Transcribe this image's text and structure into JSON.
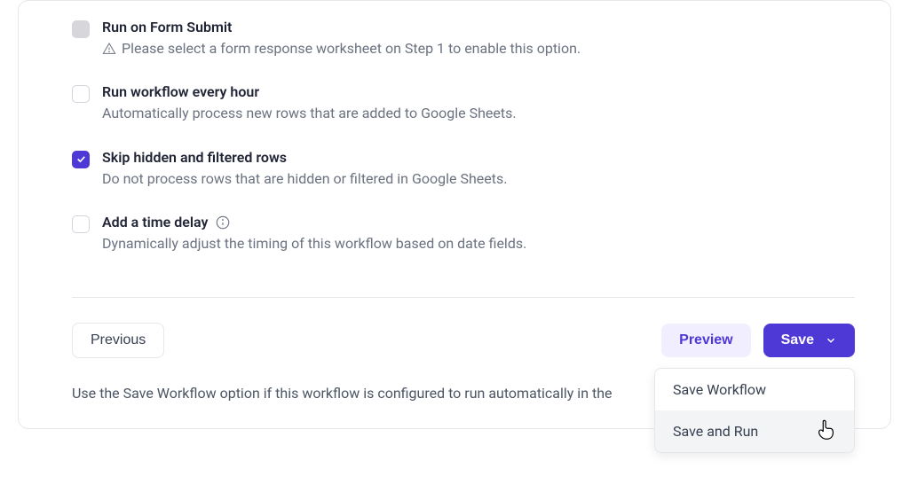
{
  "options": [
    {
      "title": "Run on Form Submit",
      "desc": "Please select a form response worksheet on Step 1 to enable this option.",
      "state": "disabled",
      "warning": true,
      "info": false
    },
    {
      "title": "Run workflow every hour",
      "desc": "Automatically process new rows that are added to Google Sheets.",
      "state": "empty",
      "warning": false,
      "info": false
    },
    {
      "title": "Skip hidden and filtered rows",
      "desc": "Do not process rows that are hidden or filtered in Google Sheets.",
      "state": "checked",
      "warning": false,
      "info": false
    },
    {
      "title": "Add a time delay",
      "desc": "Dynamically adjust the timing of this workflow based on date fields.",
      "state": "empty",
      "warning": false,
      "info": true
    }
  ],
  "footer": {
    "previous_label": "Previous",
    "preview_label": "Preview",
    "save_label": "Save"
  },
  "helper_text": "Use the Save Workflow option if this workflow is configured to run automatically in the",
  "dropdown": {
    "items": [
      {
        "label": "Save Workflow",
        "hovered": false
      },
      {
        "label": "Save and Run",
        "hovered": true
      }
    ]
  },
  "colors": {
    "accent": "#4f39d6",
    "text_muted": "#6b7280",
    "border": "#e5e7eb"
  }
}
